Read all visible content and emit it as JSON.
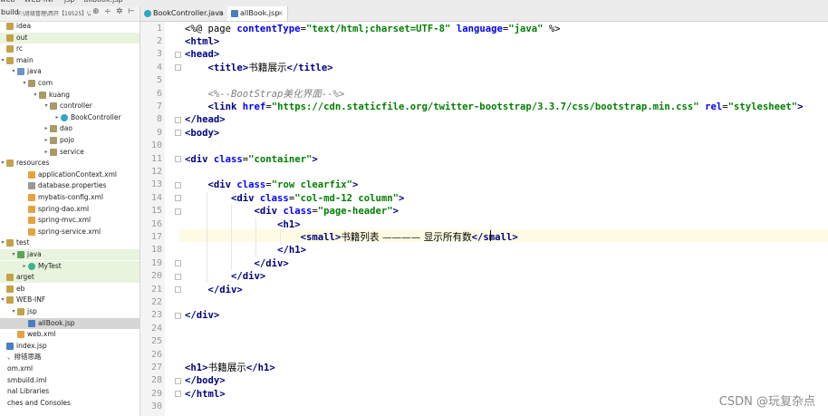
{
  "breadcrumb": {
    "items": [
      "web",
      "WEB-INF",
      "jsp",
      "allBook.jsp"
    ]
  },
  "project_panel": {
    "title": "build",
    "path": "F:\\班级管理\\西开【19525】\\2、代码\\ssm",
    "items": [
      {
        "label": "idea",
        "depth": 0,
        "icon": "folder",
        "twisty": ""
      },
      {
        "label": "out",
        "depth": 0,
        "icon": "folder",
        "twisty": "",
        "highlight": "green"
      },
      {
        "label": "rc",
        "depth": 0,
        "icon": "folder",
        "twisty": ""
      },
      {
        "label": "main",
        "depth": 0,
        "icon": "folder",
        "twisty": "v"
      },
      {
        "label": "java",
        "depth": 1,
        "icon": "folder-blue",
        "twisty": "v"
      },
      {
        "label": "com",
        "depth": 2,
        "icon": "package",
        "twisty": "v"
      },
      {
        "label": "kuang",
        "depth": 3,
        "icon": "package",
        "twisty": "v"
      },
      {
        "label": "controller",
        "depth": 4,
        "icon": "package",
        "twisty": "v"
      },
      {
        "label": "BookController",
        "depth": 5,
        "icon": "class",
        "twisty": ">"
      },
      {
        "label": "dao",
        "depth": 4,
        "icon": "package",
        "twisty": ">"
      },
      {
        "label": "pojo",
        "depth": 4,
        "icon": "package",
        "twisty": ">"
      },
      {
        "label": "service",
        "depth": 4,
        "icon": "package",
        "twisty": ">"
      },
      {
        "label": "resources",
        "depth": 0,
        "icon": "folder",
        "twisty": "v"
      },
      {
        "label": "applicationContext.xml",
        "depth": 2,
        "icon": "xml",
        "twisty": ""
      },
      {
        "label": "database.properties",
        "depth": 2,
        "icon": "properties",
        "twisty": ""
      },
      {
        "label": "mybatis-config.xml",
        "depth": 2,
        "icon": "xml",
        "twisty": ""
      },
      {
        "label": "spring-dao.xml",
        "depth": 2,
        "icon": "xml",
        "twisty": ""
      },
      {
        "label": "spring-mvc.xml",
        "depth": 2,
        "icon": "xml",
        "twisty": ""
      },
      {
        "label": "spring-service.xml",
        "depth": 2,
        "icon": "xml",
        "twisty": ""
      },
      {
        "label": "test",
        "depth": 0,
        "icon": "folder",
        "twisty": "v"
      },
      {
        "label": "java",
        "depth": 1,
        "icon": "folder-green",
        "twisty": "v",
        "highlight": "green"
      },
      {
        "label": "MyTest",
        "depth": 2,
        "icon": "test-class",
        "twisty": ">",
        "highlight": "green"
      },
      {
        "label": "arget",
        "depth": 0,
        "icon": "folder",
        "twisty": "",
        "highlight": "green"
      },
      {
        "label": "eb",
        "depth": 0,
        "icon": "folder",
        "twisty": ""
      },
      {
        "label": "WEB-INF",
        "depth": 0,
        "icon": "folder",
        "twisty": "v"
      },
      {
        "label": "jsp",
        "depth": 1,
        "icon": "folder",
        "twisty": "v"
      },
      {
        "label": "allBook.jsp",
        "depth": 2,
        "icon": "jsp",
        "twisty": "",
        "highlight": "selected"
      },
      {
        "label": "web.xml",
        "depth": 1,
        "icon": "xml",
        "twisty": ""
      },
      {
        "label": "index.jsp",
        "depth": 0,
        "icon": "jsp",
        "twisty": ""
      },
      {
        "label": "、排错思路",
        "depth": 0,
        "icon": "none",
        "twisty": ""
      },
      {
        "label": "om.xml",
        "depth": 0,
        "icon": "none",
        "twisty": ""
      },
      {
        "label": "smbuild.iml",
        "depth": 0,
        "icon": "none",
        "twisty": ""
      },
      {
        "label": "nal Libraries",
        "depth": 0,
        "icon": "none",
        "twisty": ""
      },
      {
        "label": "ches and Consoles",
        "depth": 0,
        "icon": "none",
        "twisty": ""
      }
    ]
  },
  "tabs": [
    {
      "label": "BookController.java",
      "active": false
    },
    {
      "label": "allBook.jsp",
      "active": true
    }
  ],
  "editor": {
    "lines": [
      [
        [
          "plain",
          "<%@ page "
        ],
        [
          "attr",
          "contentType"
        ],
        [
          "plain",
          "="
        ],
        [
          "str",
          "\"text/html;charset=UTF-8\""
        ],
        [
          "plain",
          " "
        ],
        [
          "attr",
          "language"
        ],
        [
          "plain",
          "="
        ],
        [
          "str",
          "\"java\""
        ],
        [
          "plain",
          " %>"
        ]
      ],
      [
        [
          "tag",
          "<html>"
        ]
      ],
      [
        [
          "tag",
          "<head>"
        ]
      ],
      [
        [
          "plain",
          "    "
        ],
        [
          "tag",
          "<title>"
        ],
        [
          "zh",
          "书籍展示"
        ],
        [
          "tag",
          "</title>"
        ]
      ],
      [],
      [
        [
          "plain",
          "    "
        ],
        [
          "cmt",
          "<%--BootStrap美化界面--%>"
        ]
      ],
      [
        [
          "plain",
          "    "
        ],
        [
          "tag",
          "<link "
        ],
        [
          "attr",
          "href"
        ],
        [
          "plain",
          "="
        ],
        [
          "str",
          "\"https://cdn.staticfile.org/twitter-bootstrap/3.3.7/css/bootstrap.min.css\""
        ],
        [
          "plain",
          " "
        ],
        [
          "attr",
          "rel"
        ],
        [
          "plain",
          "="
        ],
        [
          "str",
          "\"stylesheet\""
        ],
        [
          "tag",
          ">"
        ]
      ],
      [
        [
          "tag",
          "</head>"
        ]
      ],
      [
        [
          "tag",
          "<body>"
        ]
      ],
      [],
      [
        [
          "tag",
          "<div "
        ],
        [
          "attr",
          "class"
        ],
        [
          "plain",
          "="
        ],
        [
          "str",
          "\"container\""
        ],
        [
          "tag",
          ">"
        ]
      ],
      [],
      [
        [
          "plain",
          "    "
        ],
        [
          "tag",
          "<div "
        ],
        [
          "attr",
          "class"
        ],
        [
          "plain",
          "="
        ],
        [
          "str",
          "\"row clearfix\""
        ],
        [
          "tag",
          ">"
        ]
      ],
      [
        [
          "plain",
          "        "
        ],
        [
          "tag",
          "<div "
        ],
        [
          "attr",
          "class"
        ],
        [
          "plain",
          "="
        ],
        [
          "str",
          "\"col-md-12 column\""
        ],
        [
          "tag",
          ">"
        ]
      ],
      [
        [
          "plain",
          "            "
        ],
        [
          "tag",
          "<div "
        ],
        [
          "attr",
          "class"
        ],
        [
          "plain",
          "="
        ],
        [
          "str",
          "\"page-header\""
        ],
        [
          "tag",
          ">"
        ]
      ],
      [
        [
          "plain",
          "                "
        ],
        [
          "tag",
          "<h1>"
        ]
      ],
      [
        [
          "plain",
          "                    "
        ],
        [
          "tag",
          "<small>"
        ],
        [
          "zh",
          "书籍列表 ———— 显示所有数"
        ],
        [
          "tag",
          "</small>"
        ]
      ],
      [
        [
          "plain",
          "                "
        ],
        [
          "tag",
          "</h1>"
        ]
      ],
      [
        [
          "plain",
          "            "
        ],
        [
          "tag",
          "</div>"
        ]
      ],
      [
        [
          "plain",
          "        "
        ],
        [
          "tag",
          "</div>"
        ]
      ],
      [
        [
          "plain",
          "    "
        ],
        [
          "tag",
          "</div>"
        ]
      ],
      [],
      [
        [
          "tag",
          "</div>"
        ]
      ],
      [],
      [],
      [],
      [
        [
          "tag",
          "<h1>"
        ],
        [
          "zh",
          "书籍展示"
        ],
        [
          "tag",
          "</h1>"
        ]
      ],
      [
        [
          "tag",
          "</body>"
        ]
      ],
      [
        [
          "tag",
          "</html>"
        ]
      ],
      []
    ]
  },
  "watermark": "CSDN @玩复杂点"
}
